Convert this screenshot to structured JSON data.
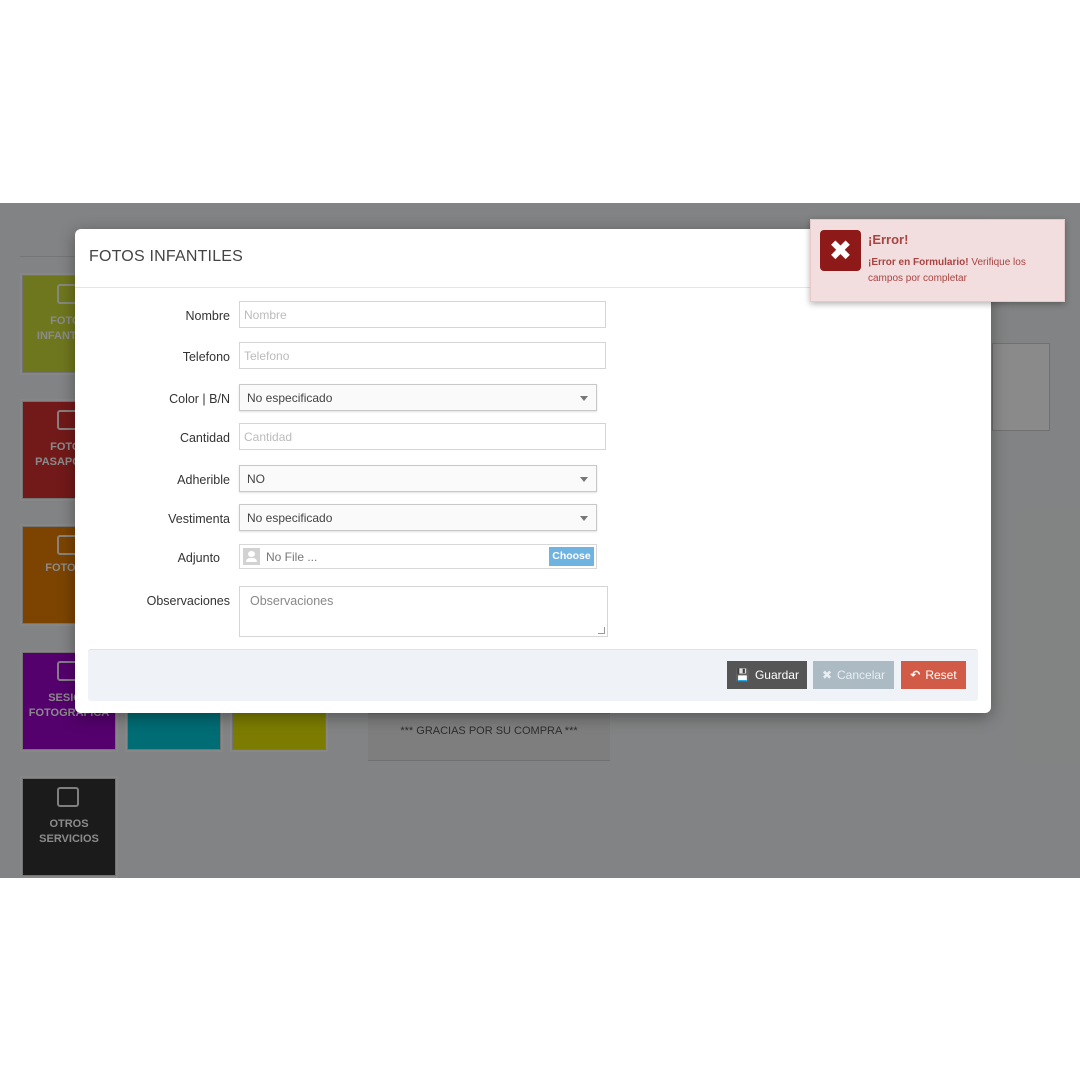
{
  "background": {
    "tiles": [
      {
        "label": "FOTOS INFANTILES",
        "color": "#cddc39"
      },
      {
        "label": "FOTOS PASAPORTE",
        "color": "#d32f2f"
      },
      {
        "label": "FOTOS T",
        "color": "#e67e00"
      },
      {
        "label": "SESION FOTOGRAFICA",
        "color": "#9c00c9"
      },
      {
        "label": "",
        "color": "#00c8d6"
      },
      {
        "label": "",
        "color": "#e3e600"
      },
      {
        "label": "OTROS SERVICIOS",
        "color": "#333333"
      }
    ],
    "thanks_text": "*** GRACIAS POR SU COMPRA ***"
  },
  "modal": {
    "title": "FOTOS INFANTILES",
    "fields": {
      "nombre": {
        "label": "Nombre",
        "placeholder": "Nombre"
      },
      "telefono": {
        "label": "Telefono",
        "placeholder": "Telefono"
      },
      "color": {
        "label": "Color | B/N",
        "value": "No especificado"
      },
      "cantidad": {
        "label": "Cantidad",
        "placeholder": "Cantidad"
      },
      "adherible": {
        "label": "Adherible",
        "value": "NO"
      },
      "vestimenta": {
        "label": "Vestimenta",
        "value": "No especificado"
      },
      "adjunto": {
        "label": "Adjunto",
        "file_text": "No File ...",
        "choose_label": "Choose"
      },
      "observaciones": {
        "label": "Observaciones",
        "placeholder": "Observaciones"
      }
    },
    "buttons": {
      "save": "Guardar",
      "cancel": "Cancelar",
      "reset": "Reset"
    }
  },
  "toast": {
    "title": "¡Error!",
    "message_bold": "¡Error en Formulario!",
    "message": " Verifique los campos por completar"
  }
}
